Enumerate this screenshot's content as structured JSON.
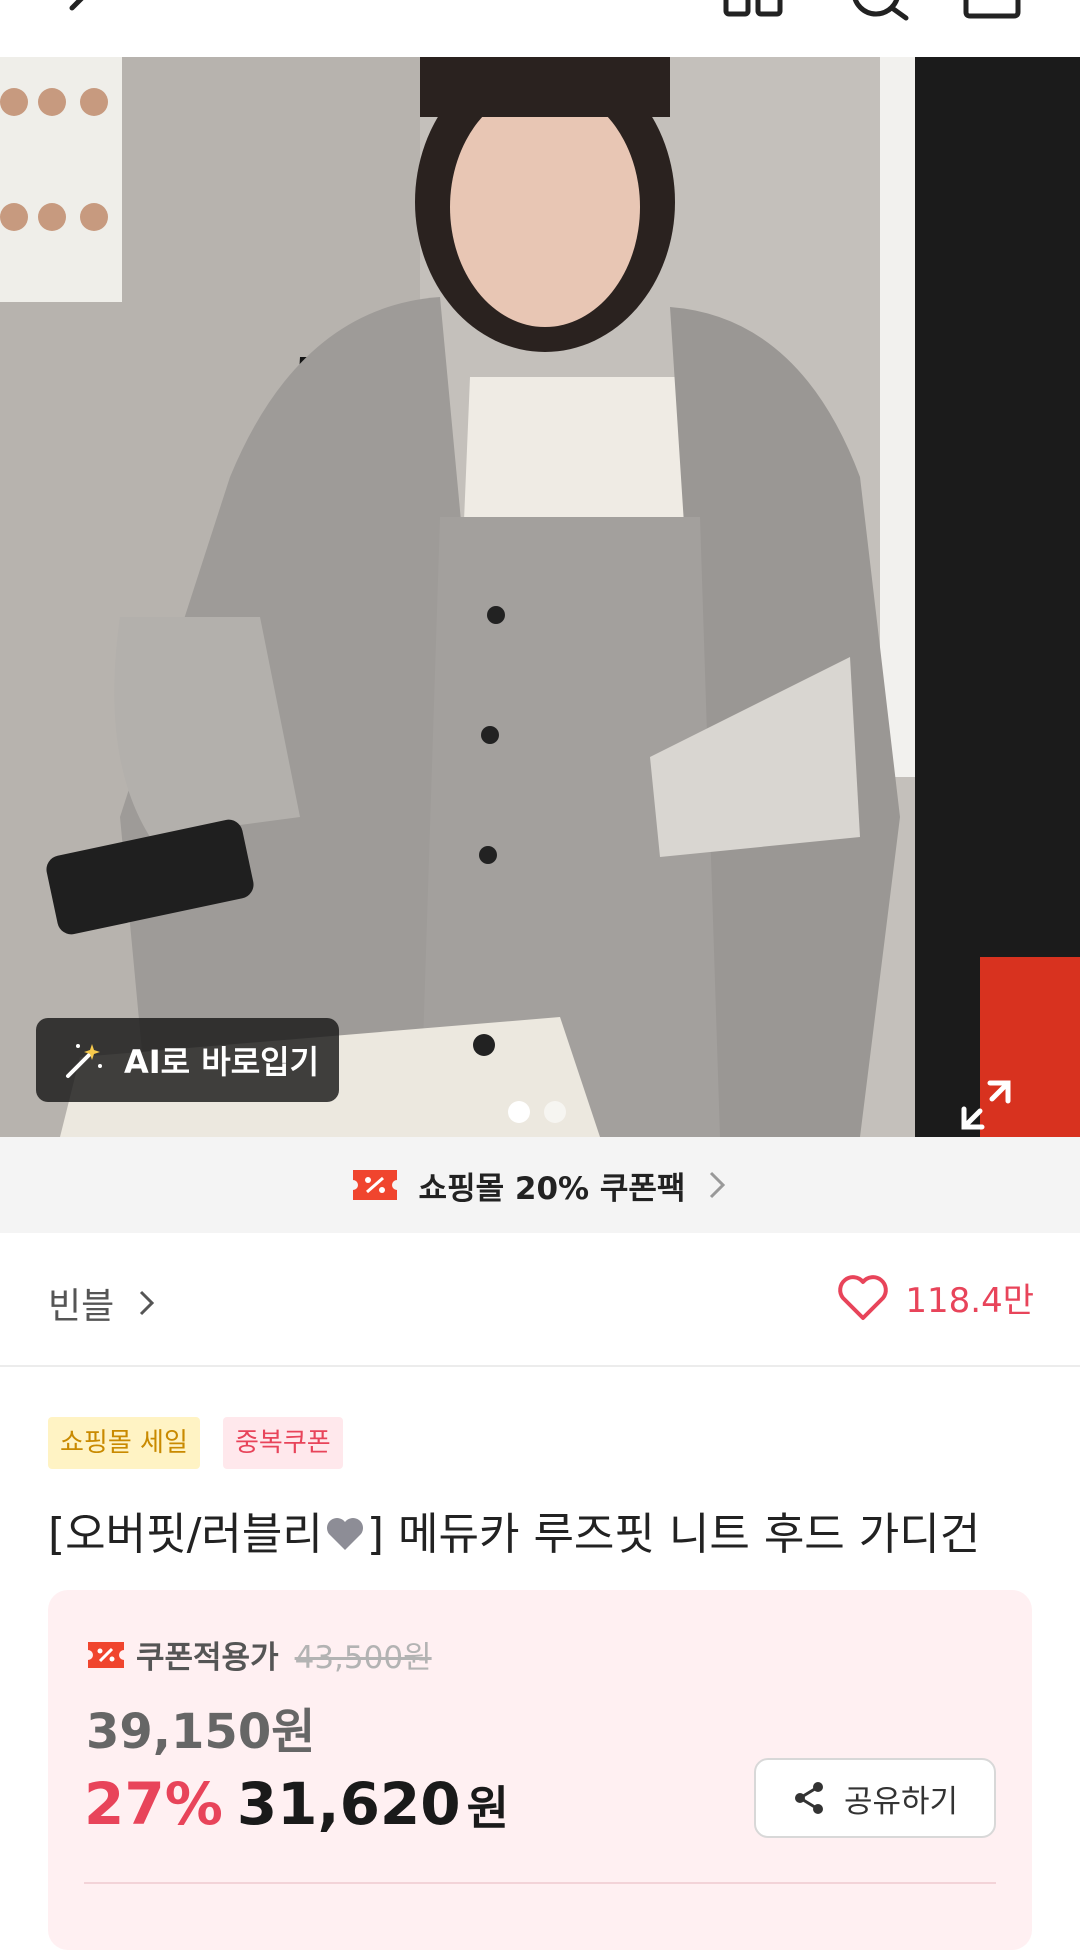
{
  "topbar": {
    "icons": [
      "back-icon",
      "category-icon",
      "search-icon",
      "cart-icon"
    ]
  },
  "hero": {
    "ai_button_label": "AI로 바로입기",
    "slide_count": 2,
    "active_slide": 1
  },
  "coupon_strip": {
    "label": "쇼핑몰 20% 쿠폰팩"
  },
  "shop": {
    "name": "빈블",
    "likes": "118.4만"
  },
  "badges": {
    "sale": "쇼핑몰 세일",
    "duplicate_coupon": "중복쿠폰"
  },
  "product": {
    "title_prefix": "[오버핏/러블리",
    "title_suffix": "] 메듀카 루즈핏 니트 후드 가디건"
  },
  "price": {
    "coupon_label": "쿠폰적용가",
    "original": "43,500원",
    "discounted": "39,150원",
    "discount_percent": "27%",
    "final_amount": "31,620",
    "currency": "원",
    "share_label": "공유하기"
  },
  "colors": {
    "accent": "#e8445a",
    "coupon": "#f0452e"
  }
}
